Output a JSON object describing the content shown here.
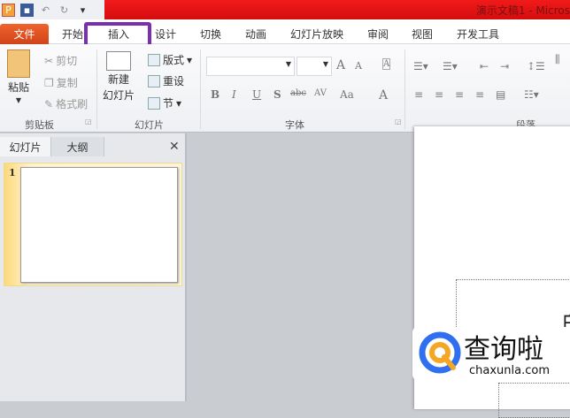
{
  "window": {
    "title": "演示文稿1 - Micros"
  },
  "qat": {
    "app_icon": "P",
    "undo": "↶",
    "redo": "↻",
    "more": "▾"
  },
  "tabs": {
    "file": "文件",
    "items": [
      "开始",
      "插入",
      "设计",
      "切换",
      "动画",
      "幻灯片放映",
      "审阅",
      "视图",
      "开发工具"
    ]
  },
  "ribbon": {
    "clipboard": {
      "label": "剪贴板",
      "paste": "粘贴",
      "cut": "剪切",
      "copy": "复制",
      "format_painter": "格式刷"
    },
    "slides": {
      "label": "幻灯片",
      "new_slide_1": "新建",
      "new_slide_2": "幻灯片",
      "layout": "版式",
      "reset": "重设",
      "section": "节"
    },
    "font": {
      "label": "字体",
      "bold": "B",
      "italic": "I",
      "underline": "U",
      "shadow": "S",
      "strike": "abc",
      "spacing": "AV",
      "case": "Aa",
      "color": "A",
      "grow": "A",
      "shrink": "A"
    },
    "paragraph": {
      "label": "段落"
    }
  },
  "pane": {
    "tab_slides": "幻灯片",
    "tab_outline": "大纲",
    "close": "✕",
    "slide_number": "1"
  },
  "slide": {
    "title_partial": "白"
  },
  "watermark": {
    "name": "查询啦",
    "domain": "chaxunla.com"
  }
}
